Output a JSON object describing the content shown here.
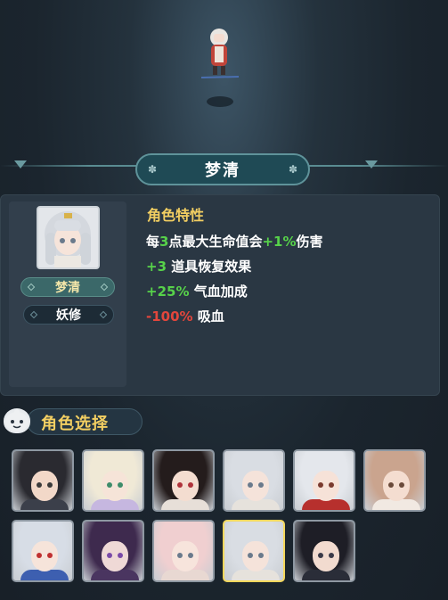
{
  "character": {
    "name": "梦清",
    "type": "妖修"
  },
  "traits": {
    "title": "角色特性",
    "lines": [
      {
        "parts": [
          {
            "t": "每",
            "c": "w"
          },
          {
            "t": "3",
            "c": "g"
          },
          {
            "t": "点最大生命值会",
            "c": "w"
          },
          {
            "t": "+1%",
            "c": "g"
          },
          {
            "t": "伤害",
            "c": "w"
          }
        ]
      },
      {
        "parts": [
          {
            "t": "+3",
            "c": "g"
          },
          {
            "t": " 道具恢复效果",
            "c": "w"
          }
        ]
      },
      {
        "parts": [
          {
            "t": "+25%",
            "c": "g"
          },
          {
            "t": " 气血加成",
            "c": "w"
          }
        ]
      },
      {
        "parts": [
          {
            "t": "-100%",
            "c": "r"
          },
          {
            "t": " 吸血",
            "c": "w"
          }
        ]
      }
    ]
  },
  "selection": {
    "title": "角色选择",
    "icon": "mascot-icon"
  },
  "roster": [
    {
      "hair": "#2a2a30",
      "skin": "#f2d8c8",
      "eye": "#3a3a3a",
      "body": "#3b3f4a",
      "selected": false
    },
    {
      "hair": "#f0e9d6",
      "skin": "#f6e4d8",
      "eye": "#3e8c6a",
      "body": "#c6b7e0",
      "selected": false
    },
    {
      "hair": "#241c1c",
      "skin": "#f4ddd0",
      "eye": "#b0323a",
      "body": "#e7dfd8",
      "selected": false
    },
    {
      "hair": "#d9dde3",
      "skin": "#f5e3da",
      "eye": "#6a7a8c",
      "body": "#e6e2dc",
      "selected": false
    },
    {
      "hair": "#e4e7ec",
      "skin": "#f6e2d8",
      "eye": "#7a3a2e",
      "body": "#b7302d",
      "selected": false
    },
    {
      "hair": "#caa48e",
      "skin": "#f4ddd0",
      "eye": "#6a4a3a",
      "body": "#f1e9e2",
      "selected": false
    },
    {
      "hair": "#d7dde6",
      "skin": "#f6e4da",
      "eye": "#c03030",
      "body": "#3d5fb0",
      "selected": false
    },
    {
      "hair": "#3e2a4e",
      "skin": "#efd9d6",
      "eye": "#7a4aa8",
      "body": "#4a3560",
      "selected": false
    },
    {
      "hair": "#f0cfd0",
      "skin": "#f7e4dc",
      "eye": "#6a7a8c",
      "body": "#e8d8d2",
      "selected": false
    },
    {
      "hair": "#d9dde3",
      "skin": "#f5e3da",
      "eye": "#6a7a8c",
      "body": "#e6e2dc",
      "selected": true
    },
    {
      "hair": "#1e1e26",
      "skin": "#f2dbcf",
      "eye": "#3a3a48",
      "body": "#2a2d38",
      "selected": false
    }
  ]
}
